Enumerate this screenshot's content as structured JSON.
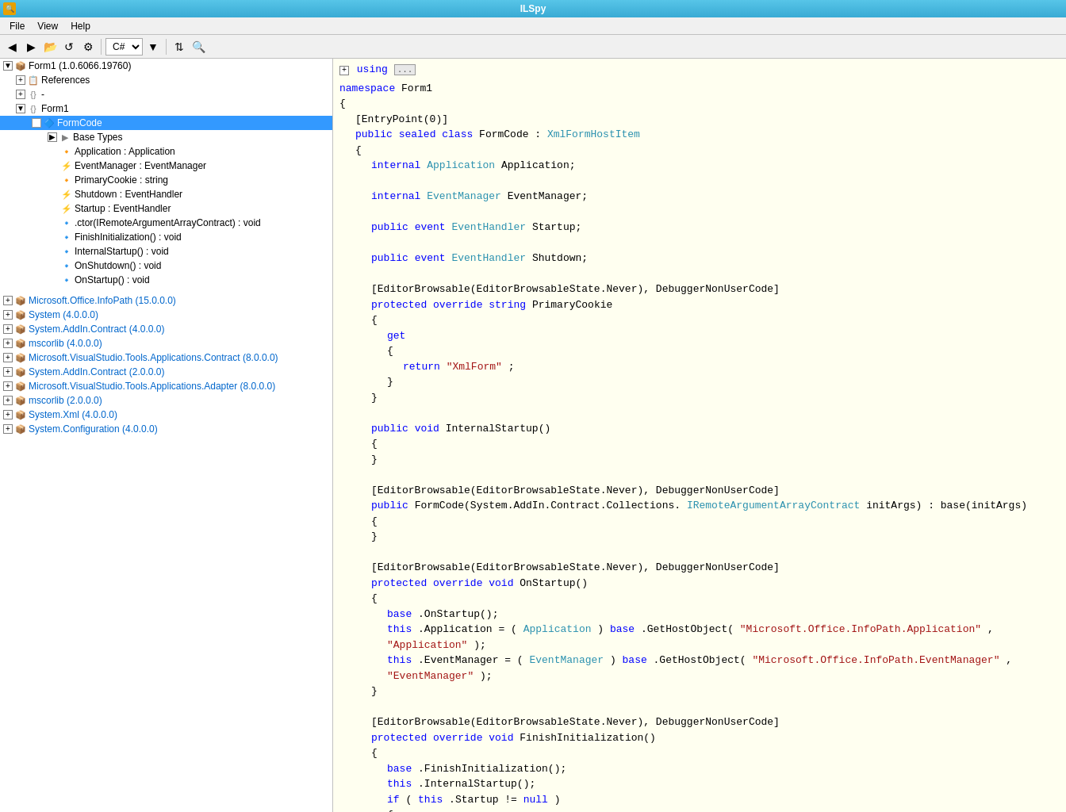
{
  "app": {
    "title": "ILSpy",
    "icon": "🔍"
  },
  "menu": {
    "items": [
      "File",
      "View",
      "Help"
    ]
  },
  "toolbar": {
    "language": "C#",
    "buttons": [
      "back",
      "forward",
      "open",
      "refresh",
      "settings",
      "sort",
      "search"
    ]
  },
  "tree": {
    "root": {
      "label": "Form1 (1.0.6066.19760)",
      "expanded": true,
      "children": [
        {
          "label": "References",
          "icon": "ref",
          "expandable": true
        },
        {
          "label": "{} -",
          "icon": "ns",
          "expandable": true
        },
        {
          "label": "{} Form1",
          "icon": "ns",
          "expandable": true,
          "children": [
            {
              "label": "FormCode",
              "icon": "class",
              "selected": true,
              "expandable": true,
              "children": [
                {
                  "label": "Base Types",
                  "icon": "ref",
                  "expandable": true,
                  "children": [
                    {
                      "label": "Application : Application",
                      "icon": "prop"
                    },
                    {
                      "label": "EventManager : EventManager",
                      "icon": "event"
                    },
                    {
                      "label": "PrimaryCookie : string",
                      "icon": "prop"
                    },
                    {
                      "label": "Shutdown : EventHandler",
                      "icon": "event"
                    },
                    {
                      "label": "Startup : EventHandler",
                      "icon": "event"
                    },
                    {
                      "label": ".ctor(IRemoteArgumentArrayContract) : void",
                      "icon": "method"
                    },
                    {
                      "label": "FinishInitialization() : void",
                      "icon": "method"
                    },
                    {
                      "label": "InternalStartup() : void",
                      "icon": "method"
                    },
                    {
                      "label": "OnShutdown() : void",
                      "icon": "method"
                    },
                    {
                      "label": "OnStartup() : void",
                      "icon": "method"
                    }
                  ]
                }
              ]
            }
          ]
        }
      ]
    },
    "assemblies": [
      {
        "label": "Microsoft.Office.InfoPath (15.0.0.0)",
        "expandable": true
      },
      {
        "label": "System (4.0.0.0)",
        "expandable": true
      },
      {
        "label": "System.AddIn.Contract (4.0.0.0)",
        "expandable": true
      },
      {
        "label": "mscorlib (4.0.0.0)",
        "expandable": true
      },
      {
        "label": "Microsoft.VisualStudio.Tools.Applications.Contract (8.0.0.0)",
        "expandable": true
      },
      {
        "label": "System.AddIn.Contract (2.0.0.0)",
        "expandable": true
      },
      {
        "label": "Microsoft.VisualStudio.Tools.Applications.Adapter (8.0.0.0)",
        "expandable": true
      },
      {
        "label": "mscorlib (2.0.0.0)",
        "expandable": true
      },
      {
        "label": "System.Xml (4.0.0.0)",
        "expandable": true
      },
      {
        "label": "System.Configuration (4.0.0.0)",
        "expandable": true
      }
    ]
  },
  "code": {
    "using_collapsed": "using ...",
    "namespace": "Form1",
    "content": "full_code"
  }
}
